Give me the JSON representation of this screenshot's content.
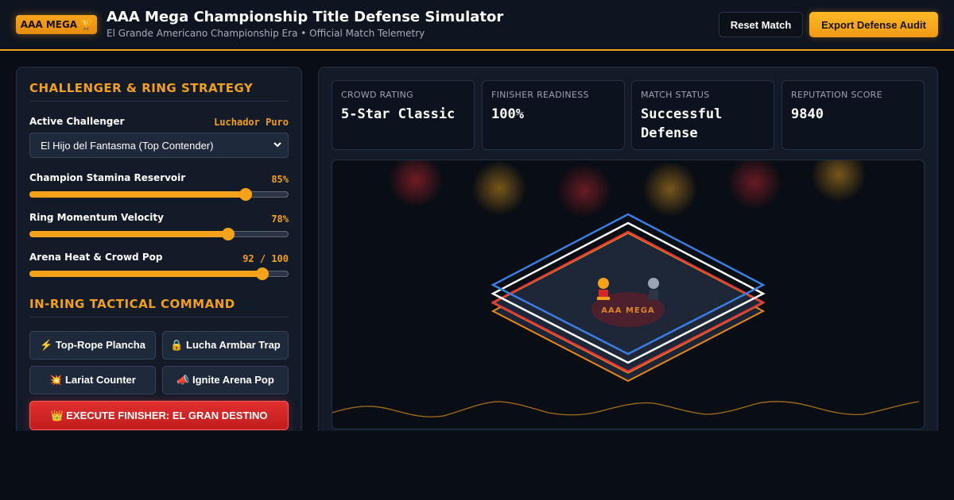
{
  "header": {
    "badge": "AAA MEGA 🏆",
    "title": "AAA Mega Championship Title Defense Simulator",
    "subtitle": "El Grande Americano Championship Era • Official Match Telemetry",
    "reset_label": "Reset Match",
    "export_label": "Export Defense Audit"
  },
  "strategy": {
    "section_title": "CHALLENGER & RING STRATEGY",
    "challenger_label": "Active Challenger",
    "challenger_style": "Luchador Puro",
    "challenger_selected": "El Hijo del Fantasma (Top Contender)",
    "sliders": [
      {
        "label": "Champion Stamina Reservoir",
        "display": "85%",
        "value": 85,
        "max": 100
      },
      {
        "label": "Ring Momentum Velocity",
        "display": "78%",
        "value": 78,
        "max": 100
      },
      {
        "label": "Arena Heat & Crowd Pop",
        "display": "92 / 100",
        "value": 92,
        "max": 100
      }
    ]
  },
  "tactical": {
    "section_title": "IN-RING TACTICAL COMMAND",
    "buttons": [
      "⚡ Top-Rope Plancha",
      "🔒 Lucha Armbar Trap",
      "💥 Lariat Counter",
      "📣 Ignite Arena Pop"
    ],
    "finisher_label": "👑 EXECUTE FINISHER: EL GRAN DESTINO"
  },
  "stats": [
    {
      "label": "CROWD RATING",
      "value": "5-Star Classic"
    },
    {
      "label": "FINISHER READINESS",
      "value": "100%"
    },
    {
      "label": "MATCH STATUS",
      "value": "Successful Defense"
    },
    {
      "label": "REPUTATION SCORE",
      "value": "9840"
    }
  ],
  "ring": {
    "mat_logo": "AAA MEGA"
  },
  "colors": {
    "accent": "#f2a01e",
    "danger": "#d92626",
    "rope_blue": "#3b7de0",
    "rope_white": "#ffffff",
    "rope_red": "#e03a3a",
    "mat": "#1c2536",
    "background": "#090d14"
  }
}
